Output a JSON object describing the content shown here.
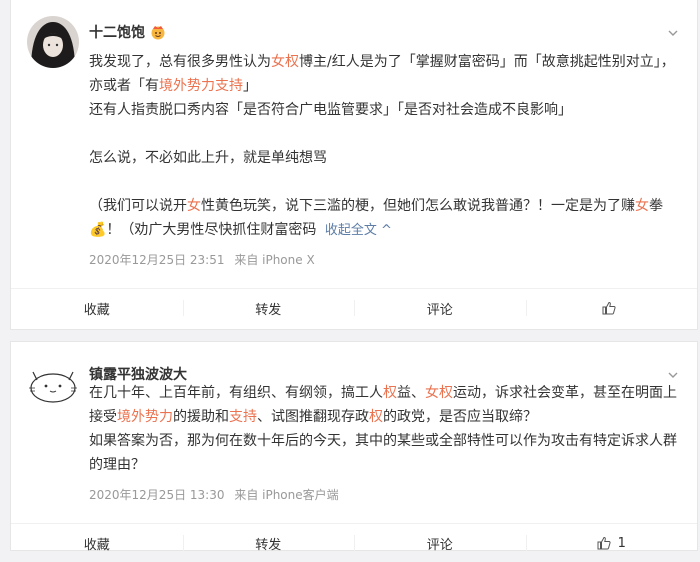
{
  "posts": [
    {
      "author": "十二饱饱",
      "badge_icon": "crown-emoji-icon",
      "paragraphs": [
        [
          {
            "t": "我发现了，总有很多男性认为"
          },
          {
            "t": "女权",
            "hl": true
          },
          {
            "t": "博主/红人是为了「掌握财富密码」而「故意挑起性别对立」，亦或者「有"
          },
          {
            "t": "境外势力支持",
            "hl": true
          },
          {
            "t": "」"
          }
        ],
        [
          {
            "t": "还有人指责脱口秀内容「是否符合广电监管要求」「是否对社会造成不良影响」"
          }
        ],
        [],
        [
          {
            "t": "怎么说，不必如此上升，就是单纯想骂"
          }
        ],
        [],
        [
          {
            "t": "（我们可以说开"
          },
          {
            "t": "女",
            "hl": true
          },
          {
            "t": "性黄色玩笑，说下三滥的梗，但她们怎么敢说我普通？！一定是为了赚"
          },
          {
            "t": "女",
            "hl": true
          },
          {
            "t": "拳💰！（劝广大男性尽快抓住财富密码 "
          }
        ]
      ],
      "collapse_label": "收起全文 ^",
      "time": "2020年12月25日 23:51",
      "source": "来自 iPhone X",
      "actions": {
        "favorite": "收藏",
        "repost": "转发",
        "comment": "评论",
        "like": ""
      }
    },
    {
      "author": "镇露平独波波大",
      "paragraphs": [
        [
          {
            "t": "在几十年、上百年前，有组织、有纲领，搞工人"
          },
          {
            "t": "权",
            "hl": true
          },
          {
            "t": "益、"
          },
          {
            "t": "女权",
            "hl": true
          },
          {
            "t": "运动，诉求社会变革，甚至在明面上接受"
          },
          {
            "t": "境外势力",
            "hl": true
          },
          {
            "t": "的援助和"
          },
          {
            "t": "支持",
            "hl": true
          },
          {
            "t": "、试图推翻现存政"
          },
          {
            "t": "权",
            "hl": true
          },
          {
            "t": "的政党，是否应当取缔？"
          }
        ],
        [
          {
            "t": "如果答案为否，那为何在数十年后的今天，其中的某些或全部特性可以作为攻击有特定诉求人群的理由？"
          }
        ]
      ],
      "time": "2020年12月25日 13:30",
      "source": "来自 iPhone客户端",
      "actions": {
        "favorite": "收藏",
        "repost": "转发",
        "comment": "评论",
        "like_count": "1"
      }
    }
  ],
  "colors": {
    "highlight": "#eb7350",
    "link": "#5d7da6",
    "meta": "#999999"
  }
}
